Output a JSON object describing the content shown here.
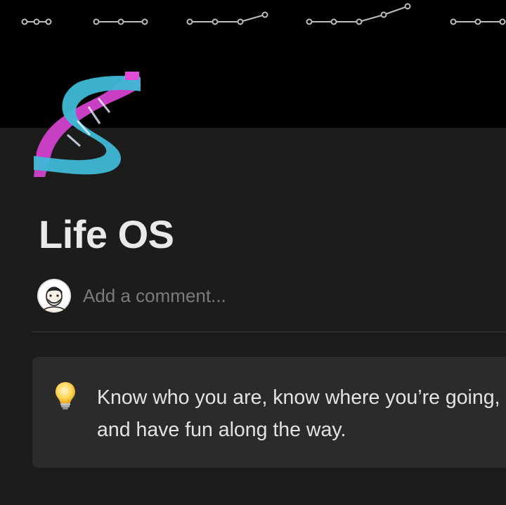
{
  "cover": {
    "description_icon": "connected-dots-pattern"
  },
  "page": {
    "icon": "dna-icon",
    "title": "Life OS"
  },
  "comment": {
    "avatar": "user-avatar",
    "placeholder": "Add a comment..."
  },
  "callout": {
    "icon": "lightbulb-icon",
    "text": "Know who you are, know where you’re going, and have fun along the way."
  },
  "colors": {
    "cover_bg": "#000000",
    "page_bg": "#1c1c1c",
    "callout_bg": "#2b2b2b",
    "title": "#e9e9e7",
    "placeholder": "#7b7b7b",
    "dna_pink": "#c93fc3",
    "dna_cyan": "#3fb8d6"
  }
}
